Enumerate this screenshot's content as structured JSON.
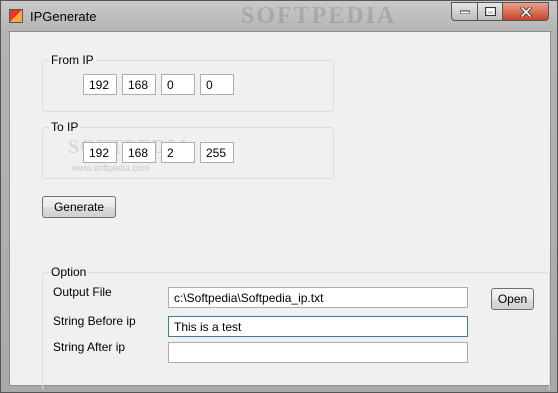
{
  "window": {
    "title": "IPGenerate",
    "watermark": "SOFTPEDIA"
  },
  "from_ip": {
    "legend": "From IP",
    "octets": [
      "192",
      "168",
      "0",
      "0"
    ]
  },
  "to_ip": {
    "legend": "To IP",
    "octets": [
      "192",
      "168",
      "2",
      "255"
    ]
  },
  "watermark_mid": "SOFTPEDIA",
  "watermark_url": "www.softpedia.com",
  "generate_label": "Generate",
  "option": {
    "legend": "Option",
    "output_file_label": "Output File",
    "output_file_value": "c:\\Softpedia\\Softpedia_ip.txt",
    "open_label": "Open",
    "string_before_label": "String Before ip",
    "string_before_value": "This is a test",
    "string_after_label": "String After ip",
    "string_after_value": ""
  },
  "icons": [
    "app-icon",
    "minimize-icon",
    "maximize-icon",
    "close-icon"
  ],
  "colors": {
    "close_button": "#c7422a",
    "focus_border": "#3d7bad"
  }
}
